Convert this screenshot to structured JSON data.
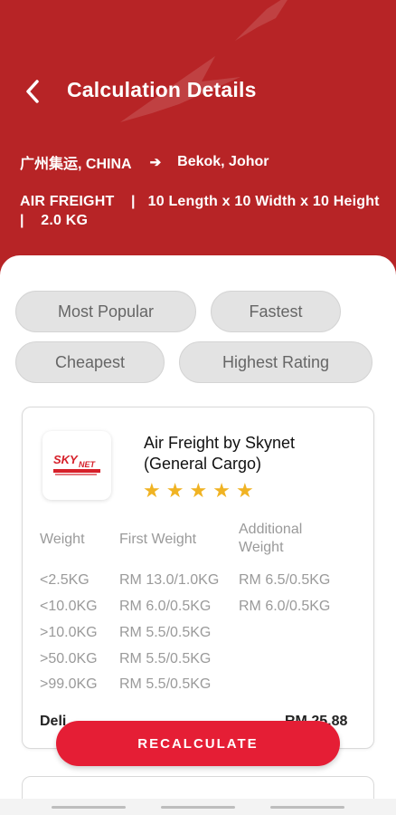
{
  "header": {
    "title": "Calculation Details",
    "origin": "广州集运, CHINA",
    "arrow": "➔",
    "destination": "Bekok, Johor",
    "cargo_info": "AIR FREIGHT    |   10 Length x 10 Width x 10 Height    |    2.0 KG"
  },
  "filters": [
    "Most Popular",
    "Fastest",
    "Cheapest",
    "Highest Rating"
  ],
  "result": {
    "logo_text": "SKYNET",
    "carrier": "Air Freight by Skynet (General Cargo)",
    "rating": 5,
    "columns": [
      "Weight",
      "First Weight",
      "Additional Weight"
    ],
    "rows": [
      [
        "<2.5KG",
        "RM 13.0/1.0KG",
        "RM 6.5/0.5KG"
      ],
      [
        "<10.0KG",
        "RM 6.0/0.5KG",
        "RM 6.0/0.5KG"
      ],
      [
        ">10.0KG",
        "RM 5.5/0.5KG",
        ""
      ],
      [
        ">50.0KG",
        "RM 5.5/0.5KG",
        ""
      ],
      [
        ">99.0KG",
        "RM 5.5/0.5KG",
        ""
      ]
    ],
    "delivery_text": "Deli",
    "total_text": "RM 25.88"
  },
  "actions": {
    "recalculate": "RECALCULATE"
  },
  "colors": {
    "brand_red": "#b72426",
    "button_red": "#e51e35",
    "star": "#f0b323"
  },
  "icons": {
    "back": "chevron-left-icon",
    "star": "star-icon"
  }
}
